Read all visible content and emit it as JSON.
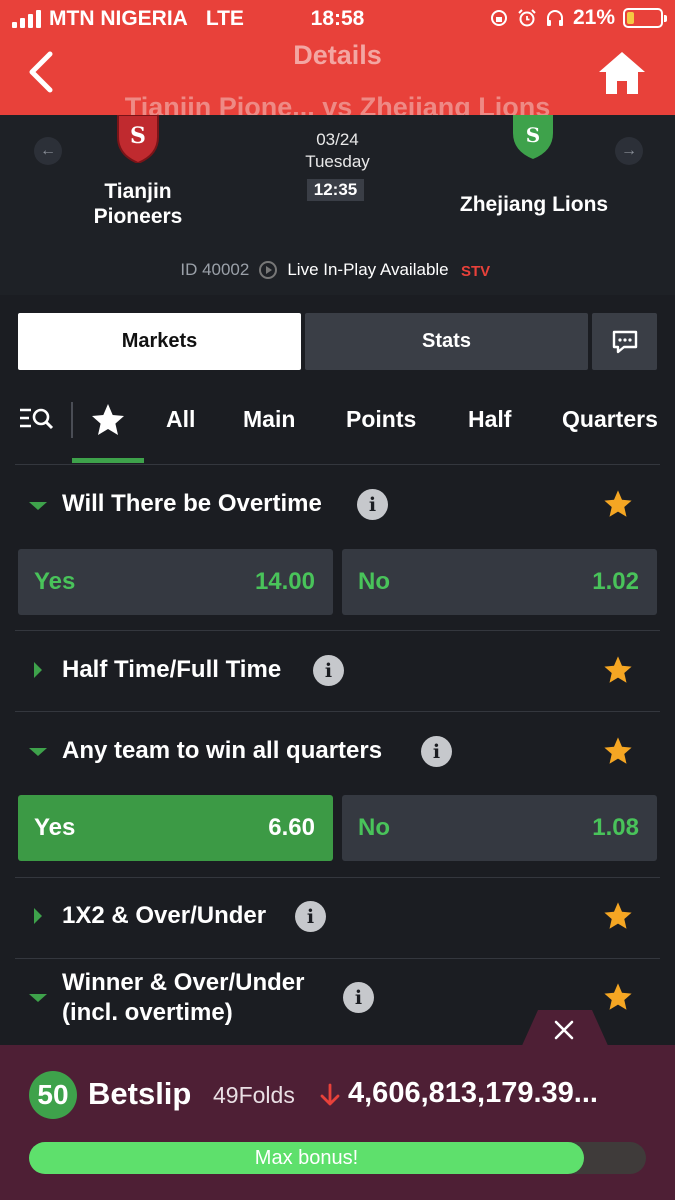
{
  "status_bar": {
    "carrier": "MTN NIGERIA",
    "network": "LTE",
    "time": "18:58",
    "battery": "21%",
    "battery_level": 0.21
  },
  "nav": {
    "title": "Details",
    "match_title": "Tianjin Pione... vs Zhejiang Lions"
  },
  "match": {
    "home_team": [
      "Tianjin",
      "Pioneers"
    ],
    "away_team": "Zhejiang Lions",
    "date": "03/24",
    "weekday": "Tuesday",
    "time": "12:35",
    "id": "ID 40002",
    "live_text": "Live In-Play Available",
    "stv_logo": "STV",
    "home_logo_letter": "S",
    "away_logo_letter": "S"
  },
  "tabs": {
    "markets": "Markets",
    "stats": "Stats"
  },
  "filters": [
    "All",
    "Main",
    "Points",
    "Half",
    "Quarters"
  ],
  "markets": [
    {
      "title": "Will There be Overtime",
      "expanded": true,
      "odds": [
        {
          "label": "Yes",
          "value": "14.00"
        },
        {
          "label": "No",
          "value": "1.02"
        }
      ]
    },
    {
      "title": "Half Time/Full Time",
      "expanded": false
    },
    {
      "title": "Any team to win all quarters",
      "expanded": true,
      "odds": [
        {
          "label": "Yes",
          "value": "6.60",
          "selected": true
        },
        {
          "label": "No",
          "value": "1.08"
        }
      ]
    },
    {
      "title": "1X2 & Over/Under",
      "expanded": false
    },
    {
      "title_line1": "Winner & Over/Under",
      "title_line2": "(incl. overtime)",
      "expanded": true
    }
  ],
  "betslip": {
    "count": "50",
    "title": "Betslip",
    "folds": "49Folds",
    "payout": "4,606,813,179.39...",
    "bonus_label": "Max bonus!",
    "bonus_progress": 0.9
  },
  "colors": {
    "header_red": "#e8413a",
    "accent_green": "#3ea24b",
    "odds_green": "#49c35a",
    "star_orange": "#f5a623",
    "betslip_bg": "#4e1f35"
  }
}
